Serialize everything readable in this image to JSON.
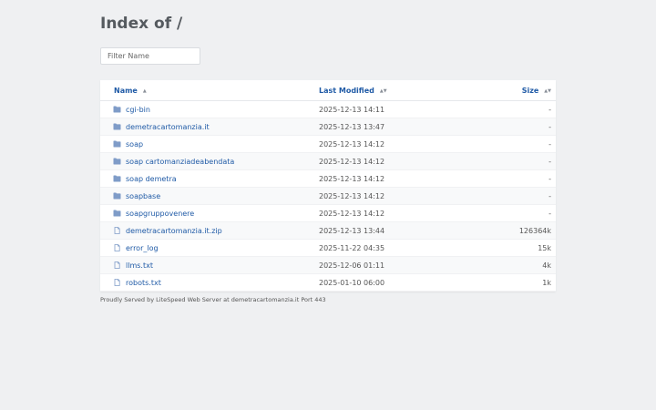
{
  "title": "Index of /",
  "filter": {
    "placeholder": "Filter Name"
  },
  "headers": {
    "name": "Name",
    "modified": "Last Modified",
    "size": "Size"
  },
  "sort_icon": "sort-icon",
  "rows": [
    {
      "icon": "folder-icon",
      "name": "cgi-bin",
      "modified": "2025-12-13 14:11",
      "size": "-"
    },
    {
      "icon": "folder-icon",
      "name": "demetracartomanzia.it",
      "modified": "2025-12-13 13:47",
      "size": "-"
    },
    {
      "icon": "folder-icon",
      "name": "soap",
      "modified": "2025-12-13 14:12",
      "size": "-"
    },
    {
      "icon": "folder-icon",
      "name": "soap cartomanziadeabendata",
      "modified": "2025-12-13 14:12",
      "size": "-"
    },
    {
      "icon": "folder-icon",
      "name": "soap demetra",
      "modified": "2025-12-13 14:12",
      "size": "-"
    },
    {
      "icon": "folder-icon",
      "name": "soapbase",
      "modified": "2025-12-13 14:12",
      "size": "-"
    },
    {
      "icon": "folder-icon",
      "name": "soapgruppovenere",
      "modified": "2025-12-13 14:12",
      "size": "-"
    },
    {
      "icon": "file-icon",
      "name": "demetracartomanzia.it.zip",
      "modified": "2025-12-13 13:44",
      "size": "126364k"
    },
    {
      "icon": "file-icon",
      "name": "error_log",
      "modified": "2025-11-22 04:35",
      "size": "15k"
    },
    {
      "icon": "file-icon",
      "name": "llms.txt",
      "modified": "2025-12-06 01:11",
      "size": "4k"
    },
    {
      "icon": "file-icon",
      "name": "robots.txt",
      "modified": "2025-01-10 06:00",
      "size": "1k"
    }
  ],
  "footer": "Proudly Served by LiteSpeed Web Server at demetracartomanzia.it Port 443",
  "colors": {
    "link": "#1f5aa6",
    "folder": "#7f9cc8",
    "background": "#eff0f2"
  }
}
